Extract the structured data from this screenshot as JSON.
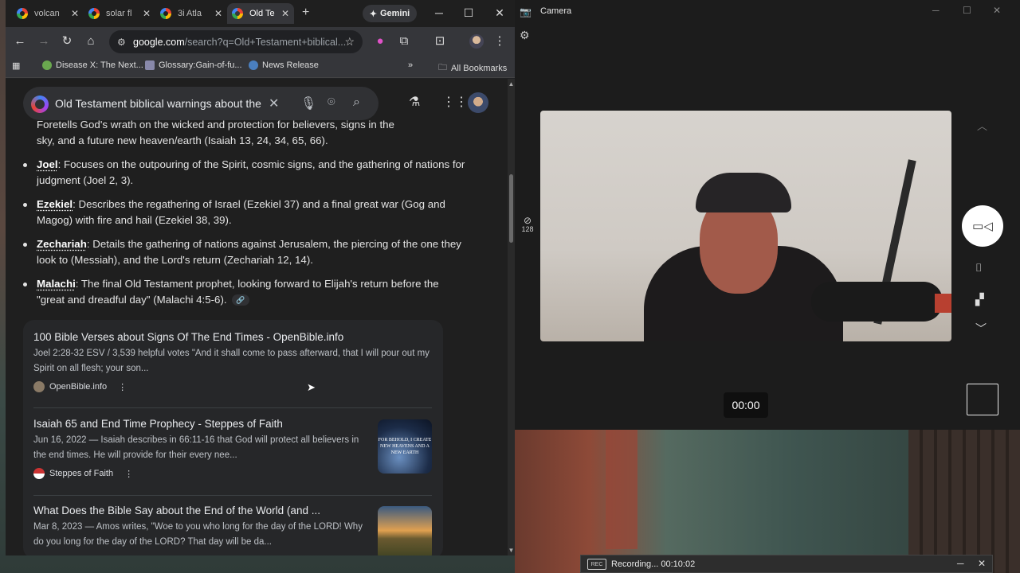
{
  "browser": {
    "tabs": [
      {
        "label": "volcan",
        "active": false
      },
      {
        "label": "solar fl",
        "active": false
      },
      {
        "label": "3i Atla",
        "active": false
      },
      {
        "label": "Old Te",
        "active": true
      }
    ],
    "new_tab_icon": "plus-icon",
    "gemini_label": "Gemini",
    "window_controls": [
      "minimize-icon",
      "maximize-icon",
      "close-icon"
    ],
    "url_host": "google.com",
    "url_path": "/search?q=Old+Testament+biblical...",
    "bookmarks": [
      {
        "label": "Disease X: The Next...",
        "color": "#6aa84f"
      },
      {
        "label": "Glossary:Gain-of-fu...",
        "color": "#8888aa"
      },
      {
        "label": "News Release",
        "color": "#4a7fbf"
      }
    ],
    "bookmarks_more": "»",
    "all_bookmarks_label": "All Bookmarks"
  },
  "search": {
    "query": "Old Testament biblical warnings about the",
    "clear_icon": "close-icon",
    "voice_icon": "mic-icon",
    "lens_icon": "camera-lens-icon",
    "search_icon": "search-icon"
  },
  "answer": {
    "partial_top": "Foretells God's wrath on the wicked and protection for believers, signs in the",
    "partial_top_line2": "sky, and a future new heaven/earth (Isaiah 13, 24, 34, 65, 66).",
    "bullets": [
      {
        "name": "Joel",
        "text": ": Focuses on the outpouring of the Spirit, cosmic signs, and the gathering of nations for judgment (Joel 2, 3)."
      },
      {
        "name": "Ezekiel",
        "text": ": Describes the regathering of Israel (Ezekiel 37) and a final great war (Gog and Magog) with fire and hail (Ezekiel 38, 39)."
      },
      {
        "name": "Zechariah",
        "text": ": Details the gathering of nations against Jerusalem, the piercing of the one they look to (Messiah), and the Lord's return (Zechariah 12, 14)."
      },
      {
        "name": "Malachi",
        "text": ": The final Old Testament prophet, looking forward to Elijah's return before the \"great and dreadful day\" (Malachi 4:5-6)."
      }
    ]
  },
  "results": [
    {
      "title": "100 Bible Verses about Signs Of The End Times - OpenBible.info",
      "snippet": "Joel 2:28-32 ESV / 3,539 helpful votes \"And it shall come to pass afterward, that I will pour out my Spirit on all flesh; your son...",
      "source": "OpenBible.info"
    },
    {
      "title": "Isaiah 65 and End Time Prophecy - Steppes of Faith",
      "snippet": "Jun 16, 2022 — Isaiah describes in 66:11-16 that God will protect all believers in the end times. He will provide for their every nee...",
      "source": "Steppes of Faith",
      "thumb_caption": "FOR BEHOLD, I CREATE NEW HEAVENS AND A NEW EARTH"
    },
    {
      "title": "What Does the Bible Say about the End of the World (and ...",
      "snippet": "Mar 8, 2023 — Amos writes, \"Woe to you who long for the day of the LORD! Why do you long for the day of the LORD? That day will be da..."
    }
  ],
  "camera": {
    "title": "Camera",
    "hdr_label": "128",
    "timer": "00:00"
  },
  "recorder": {
    "icon_text": "REC",
    "status": "Recording... 00:10:02"
  }
}
